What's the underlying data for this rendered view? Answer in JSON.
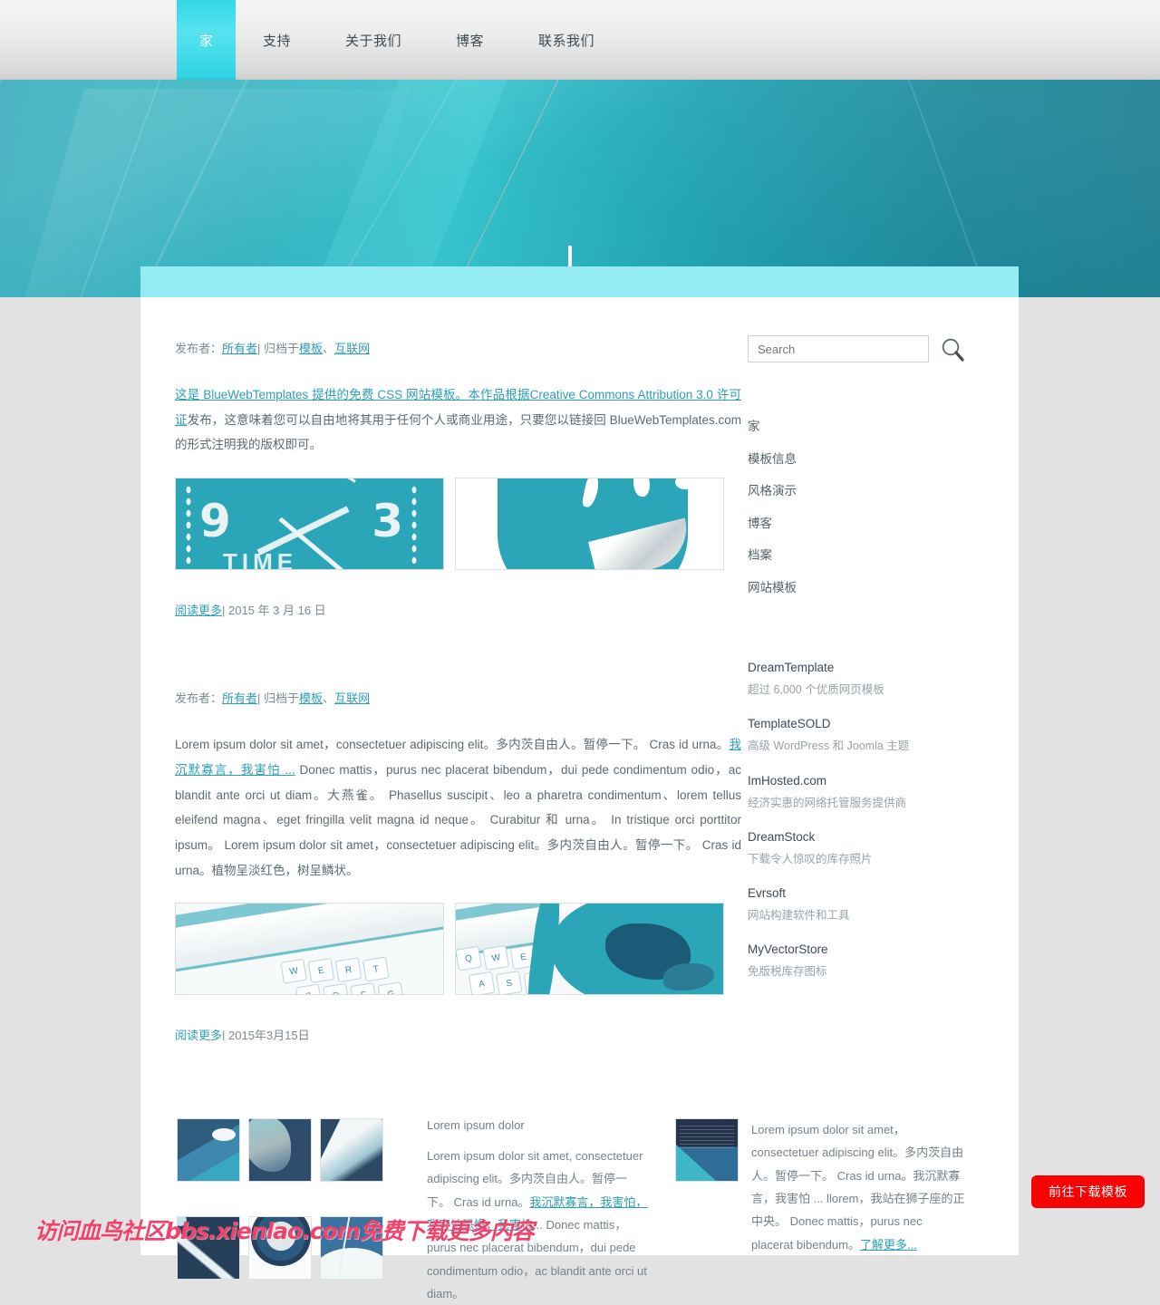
{
  "nav": {
    "items": [
      {
        "label": "家",
        "active": true
      },
      {
        "label": "支持",
        "active": false
      },
      {
        "label": "关于我们",
        "active": false
      },
      {
        "label": "博客",
        "active": false
      },
      {
        "label": "联系我们",
        "active": false
      }
    ]
  },
  "posts": [
    {
      "meta_prefix": "发布者：",
      "author": "所有者",
      "meta_sep": "| 归档于",
      "cat1": "模板",
      "cat_sep": "、",
      "cat2": "互联网",
      "body_link": "这是 BlueWebTemplates 提供的免费 CSS 网站模板。本作品根据Creative Commons Attribution 3.0 许可证",
      "body_rest": "发布，这意味着您可以自由地将其用于任何个人或商业用途，只要您以链接回 BlueWebTemplates.com 的形式注明我的版权即可。",
      "images": [
        "clock-image",
        "globe-image"
      ],
      "readmore": "阅读更多",
      "date_sep": "| ",
      "date": "2015 年 3 月 16 日"
    },
    {
      "meta_prefix": "发布者：",
      "author": "所有者",
      "meta_sep": "| 归档于",
      "cat1": "模板",
      "cat_sep": "、",
      "cat2": "互联网",
      "body_a": "Lorem ipsum dolor sit amet，consectetuer adipiscing elit。多内茨自由人。暂停一下。 Cras id urna。",
      "body_link": "我沉默寡言，我害怕 ...",
      "body_b": " Donec mattis，purus nec placerat bibendum，dui pede condimentum odio，ac blandit ante orci ut diam。大燕雀。 Phasellus suscipit、leo a pharetra condimentum、lorem tellus eleifend magna、eget fringilla velit magna id neque。 Curabitur 和 urna。 In tristique orci porttitor ipsum。 Lorem ipsum dolor sit amet，consectetuer adipiscing elit。多内茨自由人。暂停一下。 Cras id urna。植物呈淡红色，树呈鳞状。",
      "images": [
        "keyboard-image",
        "keyboard-map-image"
      ],
      "readmore": "阅读更多",
      "date_sep": "| ",
      "date": "2015年3月15日"
    }
  ],
  "sidebar": {
    "search": {
      "placeholder": "Search",
      "value": "",
      "icon": "search-icon"
    },
    "nav_items": [
      {
        "label": "家"
      },
      {
        "label": "模板信息"
      },
      {
        "label": "风格演示"
      },
      {
        "label": "博客"
      },
      {
        "label": "档案"
      },
      {
        "label": "网站模板"
      }
    ],
    "links": [
      {
        "title": "DreamTemplate",
        "desc": "超过 6,000 个优质网页模板"
      },
      {
        "title": "TemplateSOLD",
        "desc": "高级 WordPress 和 Joomla 主题"
      },
      {
        "title": "ImHosted.com",
        "desc": "经济实惠的网络托管服务提供商"
      },
      {
        "title": "DreamStock",
        "desc": "下载令人惊叹的库存照片"
      },
      {
        "title": "Evrsoft",
        "desc": "网站构建软件和工具"
      },
      {
        "title": "MyVectorStore",
        "desc": "免版税库存图标"
      }
    ]
  },
  "bottom": {
    "gallery": [
      "thumb-road",
      "thumb-map",
      "thumb-film",
      "thumb-wave",
      "thumb-dome",
      "thumb-arc"
    ],
    "middle": {
      "heading": "Lorem ipsum dolor",
      "body_a": "Lorem ipsum dolor sit amet, consectetuer adipiscing elit。多内茨自由人。暂停一下。 Cras id urna。",
      "body_link": "我沉默寡言，我害怕，我害怕恐惧，我害怕",
      "body_b": "... Donec mattis，purus nec placerat bibendum，dui pede condimentum odio，ac blandit ante orci ut diam。"
    },
    "right": {
      "thumb": "thumb-abstract",
      "body_a": "Lorem ipsum dolor sit amet，consectetuer adipiscing elit。多内茨自由人。暂停一下。 Cras id urna。我沉默寡言，我害怕 ... llorem，我站在狮子座的正中央。 Donec mattis，purus nec placerat bibendum。",
      "body_link": "了解更多..."
    }
  },
  "overlay": {
    "watermark": "访问血鸟社区bbs.xienlao.com免费下载更多内容",
    "download_button": "前往下载模板"
  },
  "colors": {
    "accent_cyan": "#2ba6b8",
    "nav_active": "#34d8e8",
    "panel_topbar": "#96ecf5",
    "link": "#2c9fb5",
    "download_red": "#fb0000",
    "watermark_pink": "#f2416b",
    "page_bg": "#e2e2e2"
  }
}
